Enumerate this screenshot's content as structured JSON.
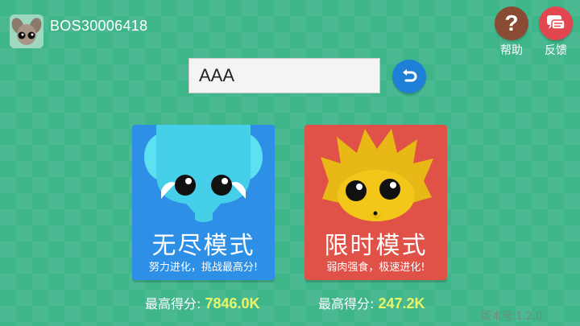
{
  "player": {
    "name": "BOS30006418"
  },
  "buttons": {
    "help_label": "帮助",
    "feedback_label": "反馈",
    "help_glyph": "?"
  },
  "name_input": {
    "value": "AAA"
  },
  "modes": [
    {
      "title": "无尽模式",
      "subtitle": "努力进化，挑战最高分!",
      "best_label": "最高得分:",
      "best_value": "7846.0K",
      "color": "#2d8fe6"
    },
    {
      "title": "限时模式",
      "subtitle": "弱肉强食，极速进化!",
      "best_label": "最高得分:",
      "best_value": "247.2K",
      "color": "#e05148"
    }
  ],
  "version": "版本号:1.2.0",
  "colors": {
    "background": "#3fb58a",
    "score_highlight": "#e8f56a",
    "help": "#8a4b35",
    "feedback": "#e2474f",
    "reset": "#1e7fd6"
  }
}
